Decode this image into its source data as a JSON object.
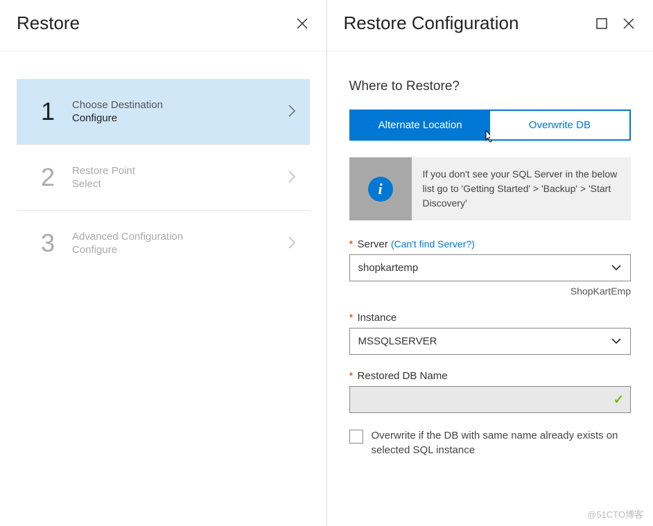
{
  "left_panel": {
    "title": "Restore",
    "steps": [
      {
        "num": "1",
        "label": "Choose Destination",
        "sub": "Configure",
        "active": true,
        "disabled": false
      },
      {
        "num": "2",
        "label": "Restore Point",
        "sub": "Select",
        "active": false,
        "disabled": true
      },
      {
        "num": "3",
        "label": "Advanced Configuration",
        "sub": "Configure",
        "active": false,
        "disabled": true
      }
    ]
  },
  "right_panel": {
    "title": "Restore Configuration",
    "section_heading": "Where to Restore?",
    "toggle": {
      "alt": "Alternate Location",
      "overwrite": "Overwrite DB"
    },
    "info_text": "If you don't see your SQL Server in the below list go to 'Getting Started' > 'Backup' > 'Start Discovery'",
    "server": {
      "label": "Server",
      "link": "(Can't find Server?)",
      "value": "shopkartemp",
      "helper": "ShopKartEmp"
    },
    "instance": {
      "label": "Instance",
      "value": "MSSQLSERVER"
    },
    "dbname": {
      "label": "Restored DB Name",
      "value": ""
    },
    "overwrite_check": {
      "label": "Overwrite if the DB with same name already exists on selected SQL instance"
    }
  },
  "watermark": "@51CTO博客"
}
